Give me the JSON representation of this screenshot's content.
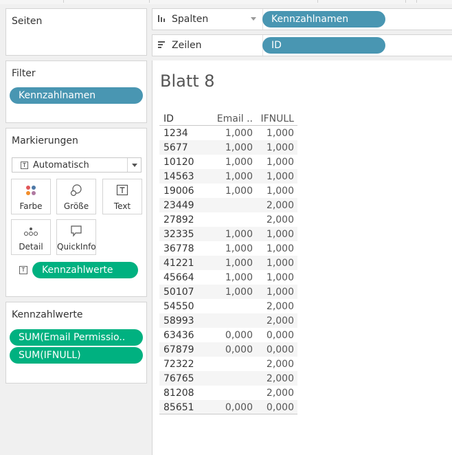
{
  "panels": {
    "pages": {
      "title": "Seiten"
    },
    "filter": {
      "title": "Filter",
      "pills": [
        "Kennzahlnamen"
      ]
    },
    "marks": {
      "title": "Markierungen",
      "mark_type": "Automatisch",
      "buttons": {
        "color": "Farbe",
        "size": "Größe",
        "text": "Text",
        "detail": "Detail",
        "tooltip": "QuickInfo"
      },
      "text_pill": "Kennzahlwerte"
    },
    "measure_values": {
      "title": "Kennzahlwerte",
      "pills": [
        "SUM(Email Permissio..",
        "SUM(IFNULL)"
      ]
    }
  },
  "shelves": {
    "columns": {
      "label": "Spalten",
      "pill": "Kennzahlnamen"
    },
    "rows": {
      "label": "Zeilen",
      "pill": "ID"
    }
  },
  "sheet": {
    "title": "Blatt 8",
    "headers": [
      "ID",
      "Email ..",
      "IFNULL"
    ],
    "rows": [
      [
        "1234",
        "1,000",
        "1,000"
      ],
      [
        "5677",
        "1,000",
        "1,000"
      ],
      [
        "10120",
        "1,000",
        "1,000"
      ],
      [
        "14563",
        "1,000",
        "1,000"
      ],
      [
        "19006",
        "1,000",
        "1,000"
      ],
      [
        "23449",
        "",
        "2,000"
      ],
      [
        "27892",
        "",
        "2,000"
      ],
      [
        "32335",
        "1,000",
        "1,000"
      ],
      [
        "36778",
        "1,000",
        "1,000"
      ],
      [
        "41221",
        "1,000",
        "1,000"
      ],
      [
        "45664",
        "1,000",
        "1,000"
      ],
      [
        "50107",
        "1,000",
        "1,000"
      ],
      [
        "54550",
        "",
        "2,000"
      ],
      [
        "58993",
        "",
        "2,000"
      ],
      [
        "63436",
        "0,000",
        "0,000"
      ],
      [
        "67879",
        "0,000",
        "0,000"
      ],
      [
        "72322",
        "",
        "2,000"
      ],
      [
        "76765",
        "",
        "2,000"
      ],
      [
        "81208",
        "",
        "2,000"
      ],
      [
        "85651",
        "0,000",
        "0,000"
      ]
    ]
  },
  "colors": {
    "dimension_pill": "#4996b2",
    "measure_pill": "#00b180"
  }
}
